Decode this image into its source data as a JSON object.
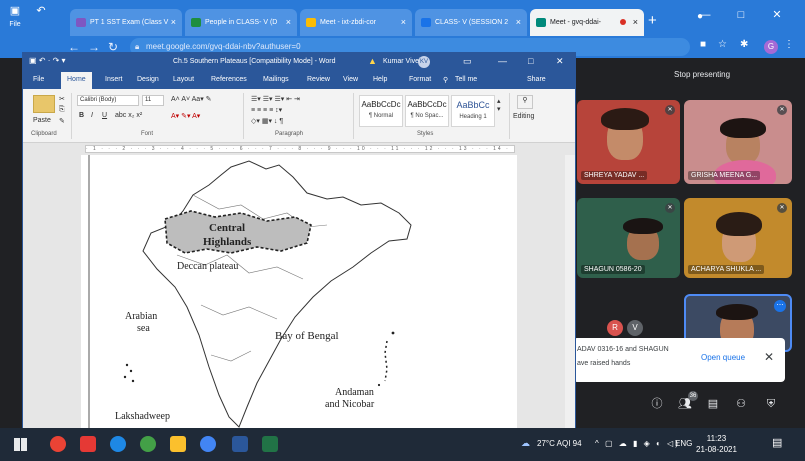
{
  "chrome": {
    "tabs": [
      {
        "label": "PT 1 SST Exam (Class V",
        "color": "#7e57c2"
      },
      {
        "label": "People in CLASS- V (D",
        "color": "#1e8e3e"
      },
      {
        "label": "Meet - ixt-zbdi-cor",
        "color": "#fbbc04"
      },
      {
        "label": "CLASS- V (SESSION 2",
        "color": "#1a73e8"
      },
      {
        "label": "Meet - gvq-ddai-",
        "color": "#00897b"
      }
    ],
    "url": "meet.google.com/gvq-ddai-nbv?authuser=0",
    "profile_initial": "G"
  },
  "word": {
    "title": "Ch.5 Southern Plateaus [Compatibility Mode] - Word",
    "user": "Kumar Vivek",
    "user_initials": "KV",
    "menu": [
      "File",
      "Home",
      "Insert",
      "Design",
      "Layout",
      "References",
      "Mailings",
      "Review",
      "View",
      "Help",
      "Format",
      "Tell me",
      "Share"
    ],
    "font_name": "Calibri (Body)",
    "font_size": "11",
    "paste_label": "Paste",
    "styles": [
      {
        "preview": "AaBbCcDc",
        "name": "¶ Normal"
      },
      {
        "preview": "AaBbCcDc",
        "name": "¶ No Spac..."
      },
      {
        "preview": "AaBbCc",
        "name": "Heading 1"
      }
    ],
    "editing_label": "Editing",
    "group_labels": [
      "Clipboard",
      "Font",
      "Paragraph",
      "Styles"
    ],
    "ruler_text": "· 1 · · · 2 · · · 3 · · · 4 · · · 5 · · · 6 · · · 7 · · · 8 · · · 9 · · · 10 · · · 11 · · · 12 · · · 13 · · · 14 · · · 15 · · · 16 · · · 17 · · · 18",
    "map_labels": {
      "central": "Central",
      "highlands": "Highlands",
      "deccan": "Deccan plateau",
      "arabian": "Arabian",
      "sea": "sea",
      "bengal": "Bay of Bengal",
      "andaman": "Andaman",
      "nicobar": "and Nicobar",
      "lakshadweep": "Lakshadweep"
    }
  },
  "meet": {
    "stop_presenting": "Stop presenting",
    "tiles": [
      {
        "name": "SHREYA YADAV ...",
        "bg": "#b7443a"
      },
      {
        "name": "GRISHA MEENA G...",
        "bg": "#c98d8d"
      },
      {
        "name": "SHAGUN 0586-20",
        "bg": "#2f5f4b"
      },
      {
        "name": "ACHARYA SHUKLA ...",
        "bg": "#c28a2c"
      },
      {
        "name": "",
        "bg": "#3c4a63"
      }
    ],
    "avatar_r": "R",
    "avatar_v": "V",
    "popup_line1": "ADAV 0316-16 and SHAGUN",
    "popup_line2": "ave raised hands",
    "open_queue": "Open queue",
    "people_count": "36"
  },
  "taskbar": {
    "weather": "27°C AQI 94",
    "lang": "ENG",
    "time": "11:23",
    "date": "21-08-2021"
  }
}
